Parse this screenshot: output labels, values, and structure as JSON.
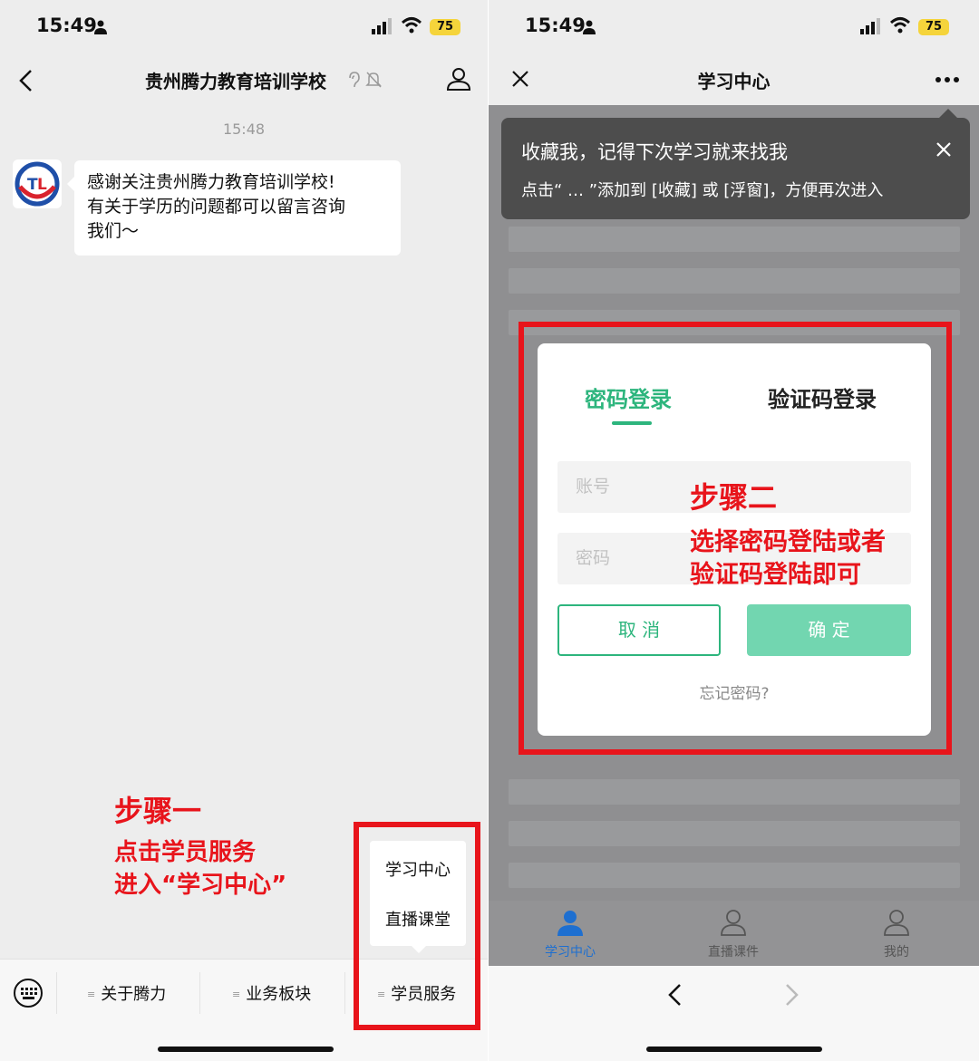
{
  "left": {
    "status": {
      "time": "15:49",
      "battery": "75"
    },
    "nav": {
      "title": "贵州腾力教育培训学校"
    },
    "chat": {
      "time": "15:48",
      "lines": [
        "感谢关注贵州腾力教育培训学校!",
        "有关于学历的问题都可以留言咨询",
        "我们～"
      ]
    },
    "popup_menu": [
      "学习中心",
      "直播课堂"
    ],
    "bottom_menu": [
      "关于腾力",
      "业务板块",
      "学员服务"
    ],
    "annotation": {
      "title": "步骤一",
      "lines": [
        "点击学员服务",
        "进入“学习中心”"
      ]
    }
  },
  "right": {
    "status": {
      "time": "15:49",
      "battery": "75"
    },
    "nav": {
      "title": "学习中心"
    },
    "tip": {
      "title": "收藏我，记得下次学习就来找我",
      "sub": "点击“ … ”添加到 [收藏] 或 [浮窗]，方便再次进入"
    },
    "dialog": {
      "tabs": [
        "密码登录",
        "验证码登录"
      ],
      "account_placeholder": "账号",
      "password_placeholder": "密码",
      "cancel": "取 消",
      "confirm": "确 定",
      "forgot": "忘记密码?"
    },
    "annotation": {
      "title": "步骤二",
      "lines": [
        "选择密码登陆或者",
        "验证码登陆即可"
      ]
    },
    "tabbar": [
      "学习中心",
      "直播课件",
      "我的"
    ]
  },
  "colors": {
    "accent": "#2db57d",
    "annotation": "#e8141b",
    "wechat_bg": "#ededed"
  }
}
